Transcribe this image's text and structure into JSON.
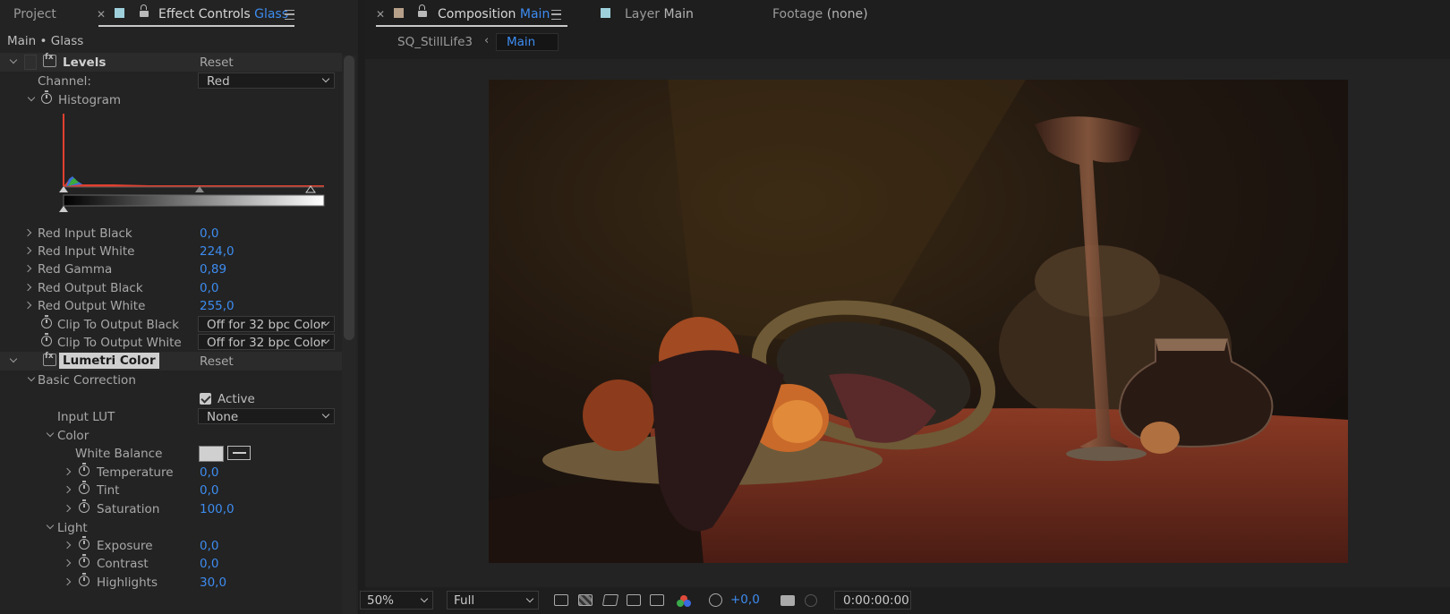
{
  "left_tabs": {
    "project": "Project",
    "effect_controls": "Effect Controls",
    "effect_controls_layer": "Glass"
  },
  "breadcrumb": "Main • Glass",
  "levels": {
    "name": "Levels",
    "reset": "Reset",
    "channel_label": "Channel:",
    "channel_value": "Red",
    "histogram_label": "Histogram",
    "params": [
      {
        "label": "Red Input Black",
        "value": "0,0"
      },
      {
        "label": "Red Input White",
        "value": "224,0"
      },
      {
        "label": "Red Gamma",
        "value": "0,89"
      },
      {
        "label": "Red Output Black",
        "value": "0,0"
      },
      {
        "label": "Red Output White",
        "value": "255,0"
      }
    ],
    "clip_black_label": "Clip To Output Black",
    "clip_black_value": "Off for 32 bpc Color",
    "clip_white_label": "Clip To Output White",
    "clip_white_value": "Off for 32 bpc Color"
  },
  "lumetri": {
    "name": "Lumetri Color",
    "reset": "Reset",
    "basic_correction": "Basic Correction",
    "active": "Active",
    "input_lut_label": "Input LUT",
    "input_lut_value": "None",
    "color_section": "Color",
    "white_balance": "White Balance",
    "temperature": {
      "label": "Temperature",
      "value": "0,0"
    },
    "tint": {
      "label": "Tint",
      "value": "0,0"
    },
    "saturation": {
      "label": "Saturation",
      "value": "100,0"
    },
    "light_section": "Light",
    "exposure": {
      "label": "Exposure",
      "value": "0,0"
    },
    "contrast": {
      "label": "Contrast",
      "value": "0,0"
    },
    "highlights": {
      "label": "Highlights",
      "value": "30,0"
    }
  },
  "right_tabs": {
    "composition": "Composition",
    "composition_name": "Main",
    "layer": "Layer",
    "layer_name": "Main",
    "footage": "Footage",
    "footage_value": "(none)"
  },
  "comp_breadcrumb": {
    "parent": "SQ_StillLife3",
    "current": "Main"
  },
  "viewer_bar": {
    "zoom": "50%",
    "resolution": "Full",
    "exposure": "+0,0",
    "timecode": "0:00:00:00"
  },
  "colors": {
    "accent": "#3d8cf0",
    "effect_controls_label": "#9ed0dc",
    "composition_label": "#b7a08a"
  }
}
